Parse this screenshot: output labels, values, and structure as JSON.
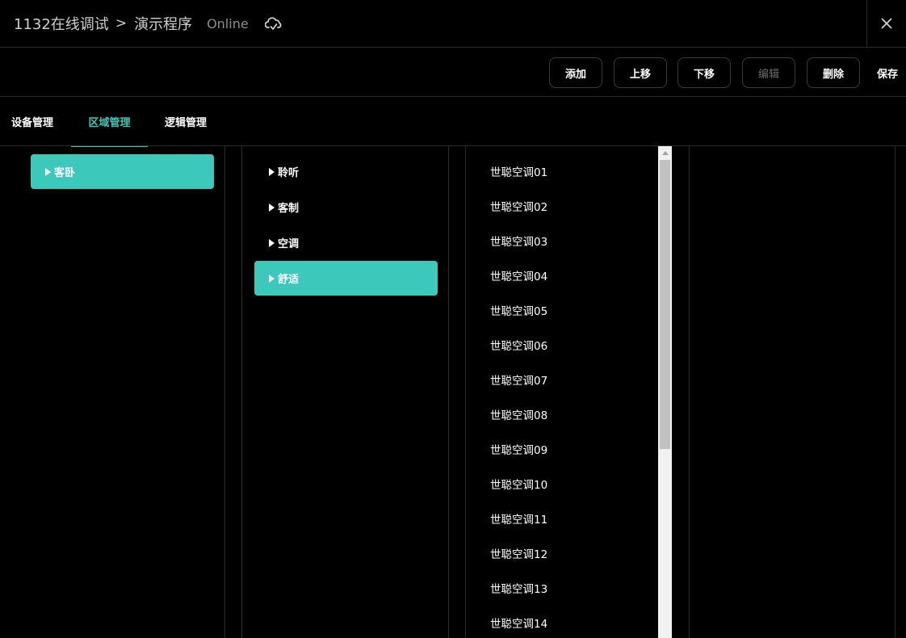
{
  "title": {
    "project": "1132在线调试",
    "separator": ">",
    "program": "演示程序",
    "status": "Online",
    "cloud_icon": "cloud-sync-icon",
    "close_icon": "close-icon"
  },
  "toolbar": {
    "add_label": "添加",
    "move_up_label": "上移",
    "move_down_label": "下移",
    "edit_label": "编辑",
    "delete_label": "删除",
    "save_label": "保存"
  },
  "tabs": [
    {
      "label": "设备管理",
      "active": false
    },
    {
      "label": "区域管理",
      "active": true
    },
    {
      "label": "逻辑管理",
      "active": false
    }
  ],
  "regions": [
    {
      "label": "客卧",
      "selected": true
    }
  ],
  "scenes": [
    {
      "label": "聆听",
      "selected": false
    },
    {
      "label": "客制",
      "selected": false
    },
    {
      "label": "空调",
      "selected": false
    },
    {
      "label": "舒适",
      "selected": true
    }
  ],
  "devices": [
    "世聪空调01",
    "世聪空调02",
    "世聪空调03",
    "世聪空调04",
    "世聪空调05",
    "世聪空调06",
    "世聪空调07",
    "世聪空调08",
    "世聪空调09",
    "世聪空调10",
    "世聪空调11",
    "世聪空调12",
    "世聪空调13",
    "世聪空调14"
  ],
  "colors": {
    "accent": "#3cc9bb",
    "background": "#000000",
    "border": "#2a2a2a",
    "disabled_text": "#6d6d6d"
  }
}
